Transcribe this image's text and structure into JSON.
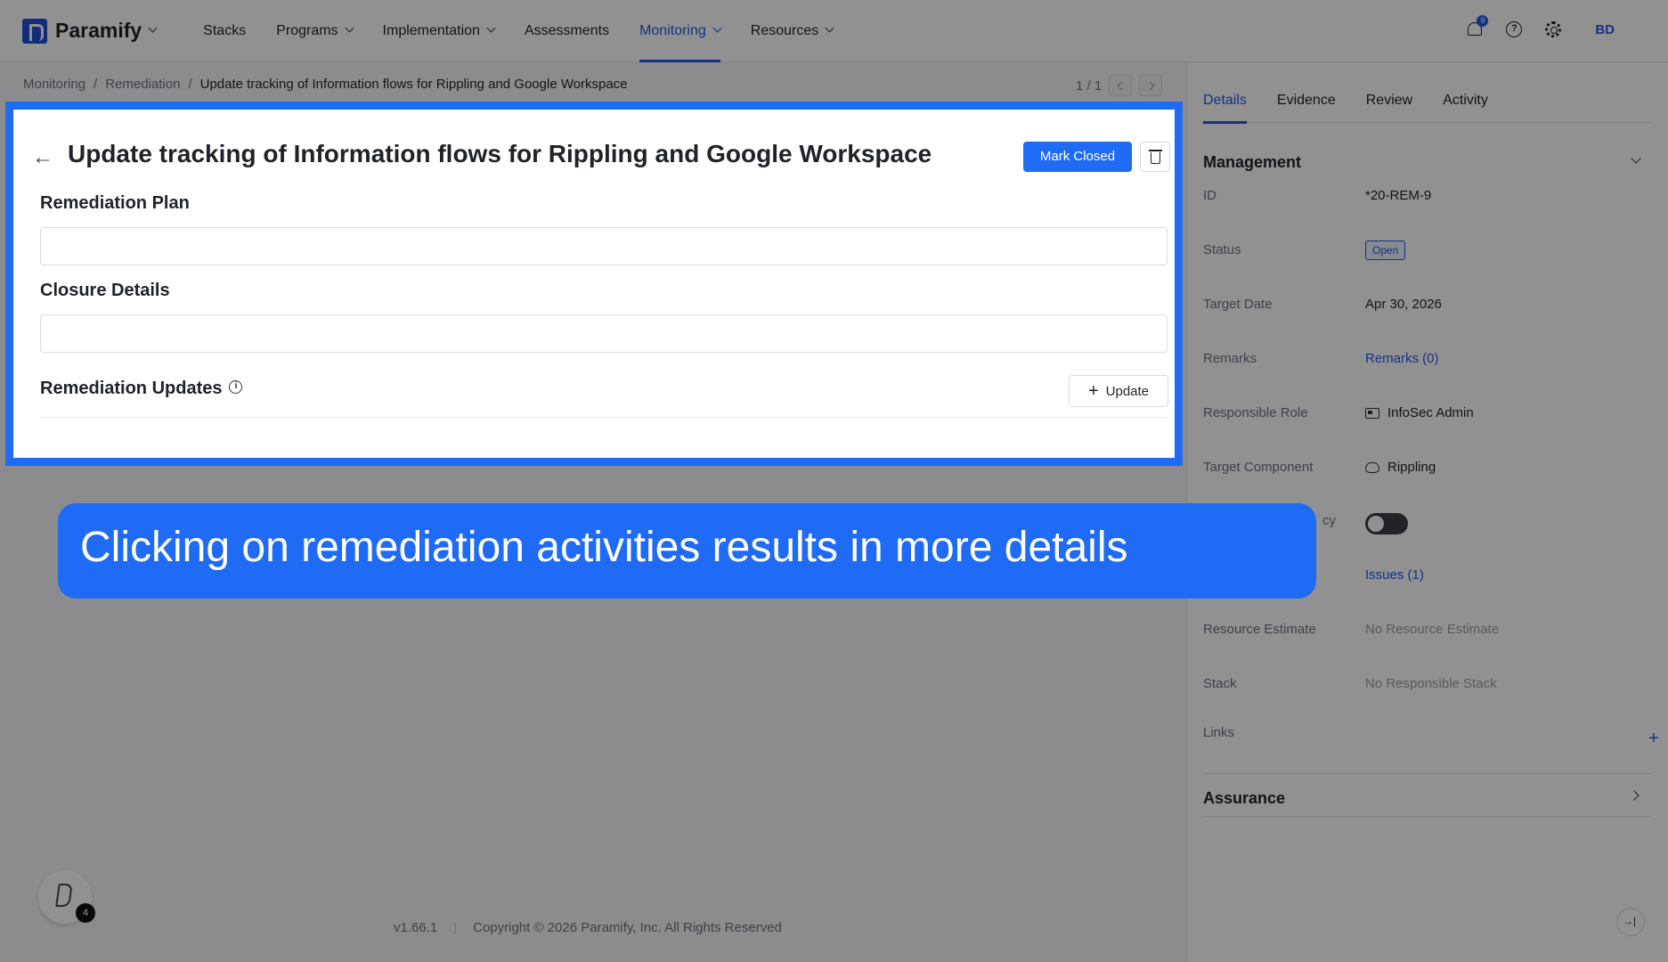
{
  "app": {
    "name": "Paramify"
  },
  "nav": {
    "items": [
      {
        "label": "Stacks",
        "has_menu": false,
        "active": false
      },
      {
        "label": "Programs",
        "has_menu": true,
        "active": false
      },
      {
        "label": "Implementation",
        "has_menu": true,
        "active": false
      },
      {
        "label": "Assessments",
        "has_menu": false,
        "active": false
      },
      {
        "label": "Monitoring",
        "has_menu": true,
        "active": true
      },
      {
        "label": "Resources",
        "has_menu": true,
        "active": false
      }
    ],
    "notification_count": "9",
    "user_initials": "BD"
  },
  "breadcrumb": {
    "items": [
      "Monitoring",
      "Remediation"
    ],
    "separator": "/",
    "current": "Update tracking of Information flows for Rippling and Google Workspace"
  },
  "pager": {
    "label": "1 / 1"
  },
  "detail": {
    "title": "Update tracking of Information flows for Rippling and Google Workspace",
    "mark_closed_label": "Mark Closed",
    "remediation_plan_label": "Remediation Plan",
    "remediation_plan_value": "",
    "closure_details_label": "Closure Details",
    "closure_details_value": "",
    "remediation_updates_label": "Remediation Updates",
    "update_button_label": "Update"
  },
  "side_panel": {
    "tabs": [
      "Details",
      "Evidence",
      "Review",
      "Activity"
    ],
    "active_tab": "Details",
    "management_title": "Management",
    "fields": {
      "id": {
        "label": "ID",
        "value": "*20-REM-9"
      },
      "status": {
        "label": "Status",
        "value": "Open"
      },
      "target_date": {
        "label": "Target Date",
        "value": "Apr 30, 2026"
      },
      "remarks": {
        "label": "Remarks",
        "value": "Remarks (0)"
      },
      "responsible_role": {
        "label": "Responsible Role",
        "value": "InfoSec Admin"
      },
      "target_component": {
        "label": "Target Component",
        "value": "Rippling"
      },
      "dependency": {
        "label": "cy",
        "value": false
      },
      "issues": {
        "label": "",
        "value": "Issues (1)"
      },
      "resource_estimate": {
        "label": "Resource Estimate",
        "value": "No Resource Estimate"
      },
      "stack": {
        "label": "Stack",
        "value": "No Responsible Stack"
      },
      "links": {
        "label": "Links"
      }
    },
    "assurance_title": "Assurance"
  },
  "footer": {
    "version": "v1.66.1",
    "copyright": "Copyright © 2026 Paramify, Inc. All Rights Reserved"
  },
  "help_widget": {
    "count": "4"
  },
  "caption": {
    "text": "Clicking on remediation activities results in more details"
  },
  "colors": {
    "accent": "#1f6bf5",
    "overlay": "rgba(0,0,0,0.43)"
  }
}
